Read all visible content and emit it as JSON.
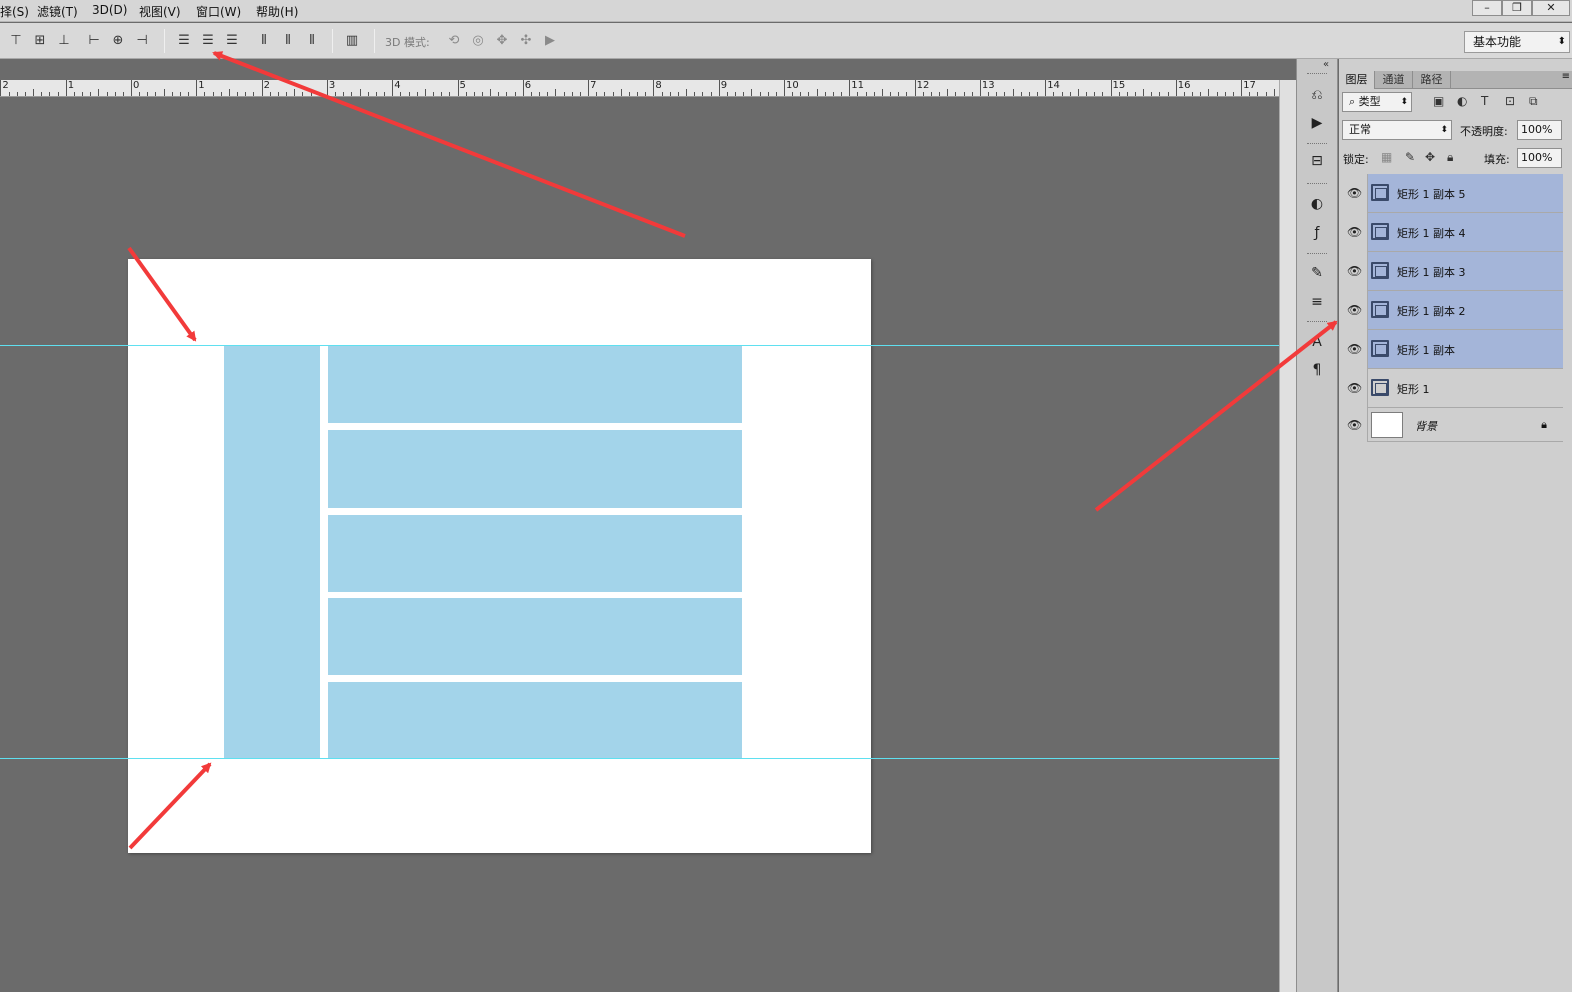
{
  "menu": {
    "items": [
      "择(S)",
      "滤镜(T)",
      "3D(D)",
      "视图(V)",
      "窗口(W)",
      "帮助(H)"
    ],
    "window_buttons": [
      "–",
      "❐",
      "✕"
    ]
  },
  "options": {
    "mode3d_label": "3D 模式:",
    "workspace": "基本功能"
  },
  "ruler": {
    "labels": [
      "2",
      "1",
      "0",
      "1",
      "2",
      "3",
      "4",
      "5",
      "6",
      "7",
      "8",
      "9",
      "10",
      "11",
      "12",
      "13",
      "14",
      "15",
      "16",
      "17"
    ]
  },
  "panel": {
    "tabs": [
      "图层",
      "通道",
      "路径"
    ],
    "filter_kind": "类型",
    "blend_mode": "正常",
    "opacity_label": "不透明度:",
    "opacity_value": "100%",
    "lock_label": "锁定:",
    "fill_label": "填充:",
    "fill_value": "100%"
  },
  "layers": [
    {
      "name": "矩形 1 副本 5",
      "selected": true
    },
    {
      "name": "矩形 1 副本 4",
      "selected": true
    },
    {
      "name": "矩形 1 副本 3",
      "selected": true
    },
    {
      "name": "矩形 1 副本 2",
      "selected": true
    },
    {
      "name": "矩形 1 副本",
      "selected": true
    },
    {
      "name": "矩形 1",
      "selected": false
    },
    {
      "name": "背景",
      "selected": false
    }
  ],
  "colors": {
    "canvas_bg": "#6b6b6b",
    "document": "#ffffff",
    "block": "#a3d4ea",
    "guide": "#5fe0f0",
    "arrow": "#f23a3a",
    "selected_layer": "#a4b5d9"
  }
}
